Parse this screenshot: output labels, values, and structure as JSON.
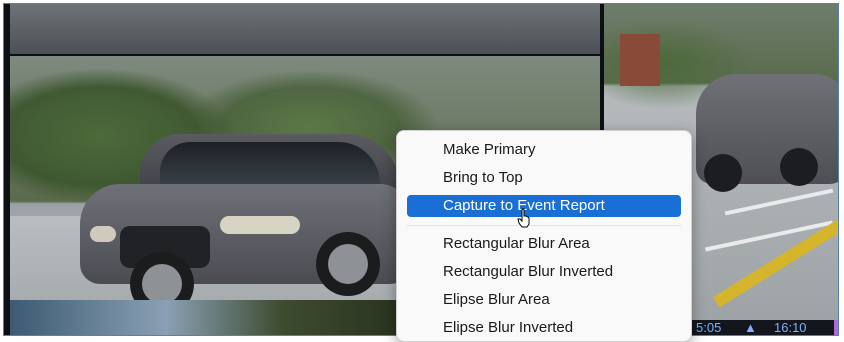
{
  "context_menu": {
    "items": [
      {
        "label": "Make Primary",
        "selected": false
      },
      {
        "label": "Bring to Top",
        "selected": false
      },
      {
        "label": "Capture to Event Report",
        "selected": true
      },
      {
        "label": "Rectangular Blur Area",
        "selected": false
      },
      {
        "label": "Rectangular Blur Inverted",
        "selected": false
      },
      {
        "label": "Elipse Blur Area",
        "selected": false
      },
      {
        "label": "Elipse Blur Inverted",
        "selected": false
      }
    ],
    "highlight_color": "#1a6fd6"
  },
  "status_strip": {
    "time_left": "5:05",
    "marker": "▲",
    "time_right": "16:10",
    "accent_color": "#b36ad6"
  },
  "icons": {
    "cursor": "pointer-hand-icon"
  }
}
